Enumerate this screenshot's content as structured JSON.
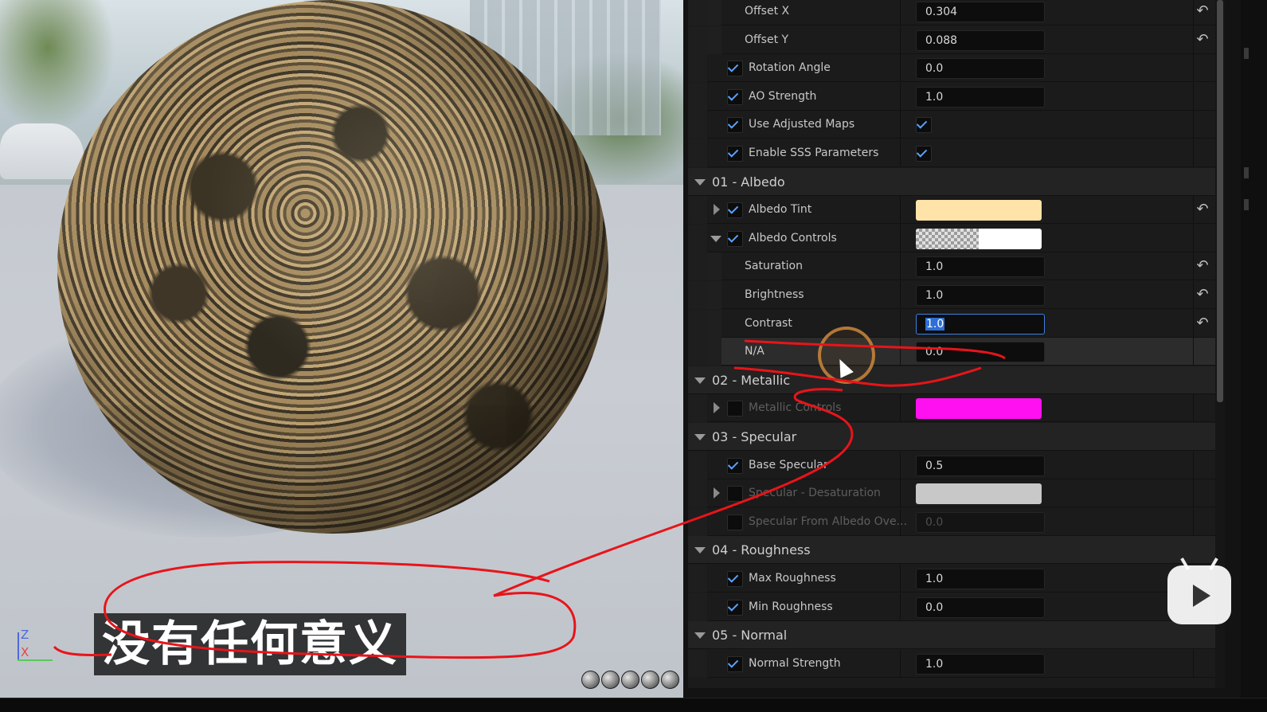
{
  "viewport": {
    "subtitle": "没有任何意义",
    "axis": {
      "z": "Z",
      "x": "X"
    },
    "view_mode_icons": [
      "cylinder-icon",
      "sphere-icon",
      "plane-icon",
      "cube-icon",
      "teapot-icon"
    ]
  },
  "panel": {
    "rows": [
      {
        "type": "param",
        "indent": "sub",
        "label": "Offset X",
        "value": "0.304",
        "reset": true
      },
      {
        "type": "param",
        "indent": "sub",
        "label": "Offset Y",
        "value": "0.088",
        "reset": true
      },
      {
        "type": "param",
        "checked": true,
        "label": "Rotation Angle",
        "value": "0.0"
      },
      {
        "type": "param",
        "checked": true,
        "label": "AO Strength",
        "value": "1.0"
      },
      {
        "type": "bool",
        "checked": true,
        "label": "Use Adjusted Maps",
        "value_checked": true
      },
      {
        "type": "bool",
        "checked": true,
        "label": "Enable SSS Parameters",
        "value_checked": true
      },
      {
        "type": "category",
        "label": "01 - Albedo"
      },
      {
        "type": "color",
        "expand": "right",
        "checked": true,
        "label": "Albedo Tint",
        "color": "#FFE3A8",
        "reset": true
      },
      {
        "type": "color",
        "expand": "down",
        "checked": true,
        "label": "Albedo Controls",
        "color": "checker",
        "reset": false
      },
      {
        "type": "param",
        "indent": "sub",
        "label": "Saturation",
        "value": "1.0",
        "reset": true
      },
      {
        "type": "param",
        "indent": "sub",
        "label": "Brightness",
        "value": "1.0",
        "reset": true
      },
      {
        "type": "param",
        "indent": "sub",
        "label": "Contrast",
        "value": "1.0",
        "reset": true,
        "active": true
      },
      {
        "type": "param",
        "indent": "sub",
        "label": "N/A",
        "value": "0.0",
        "highlight": true
      },
      {
        "type": "category",
        "label": "02 - Metallic"
      },
      {
        "type": "color",
        "expand": "right",
        "checked": false,
        "dim": true,
        "label": "Metallic Controls",
        "color": "#FF10F0"
      },
      {
        "type": "category",
        "label": "03 - Specular"
      },
      {
        "type": "param",
        "checked": true,
        "label": "Base Specular",
        "value": "0.5"
      },
      {
        "type": "color",
        "expand": "right",
        "checked": false,
        "dim": true,
        "label": "Specular - Desaturation",
        "color": "#C8C8C8"
      },
      {
        "type": "param",
        "checked": false,
        "dim": true,
        "label": "Specular From Albedo Ove...",
        "value": "0.0"
      },
      {
        "type": "category",
        "label": "04 - Roughness"
      },
      {
        "type": "param",
        "checked": true,
        "label": "Max Roughness",
        "value": "1.0"
      },
      {
        "type": "param",
        "checked": true,
        "label": "Min Roughness",
        "value": "0.0"
      },
      {
        "type": "category",
        "label": "05 - Normal"
      },
      {
        "type": "param",
        "checked": true,
        "label": "Normal Strength",
        "value": "1.0"
      }
    ],
    "reset_icon": "reset-arrow-icon",
    "watermark_icon": "bilibili-logo-icon"
  },
  "colors": {
    "accent": "#5AA3FF",
    "annotation": "#E8141A"
  }
}
